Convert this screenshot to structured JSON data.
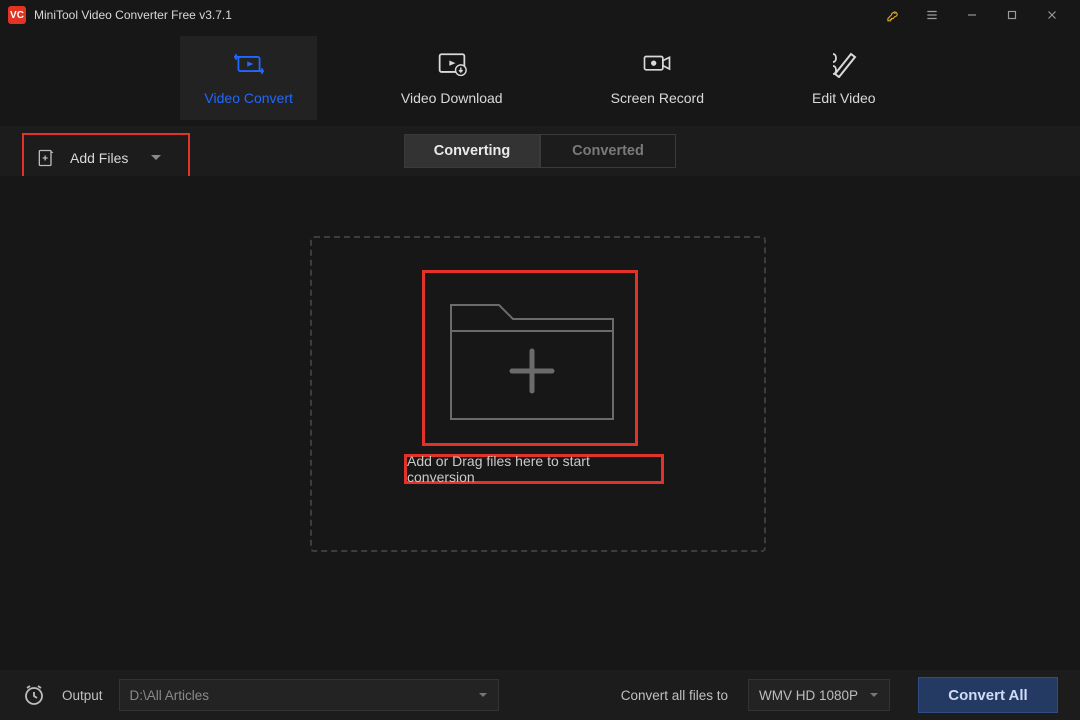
{
  "app": {
    "title": "MiniTool Video Converter Free v3.7.1",
    "logo_text": "VC"
  },
  "tabs": {
    "video_convert": "Video Convert",
    "video_download": "Video Download",
    "screen_record": "Screen Record",
    "edit_video": "Edit Video"
  },
  "toolbar": {
    "add_files": "Add Files",
    "segments": {
      "converting": "Converting",
      "converted": "Converted"
    }
  },
  "dropzone": {
    "hint": "Add or Drag files here to start conversion"
  },
  "bottom": {
    "output_label": "Output",
    "output_path": "D:\\All Articles",
    "convert_all_label": "Convert all files to",
    "format_selected": "WMV HD 1080P",
    "convert_all_button": "Convert All"
  },
  "icons": {
    "key": "key-icon",
    "menu": "menu-icon",
    "minimize": "minimize-icon",
    "maximize": "maximize-icon",
    "close": "close-icon"
  }
}
